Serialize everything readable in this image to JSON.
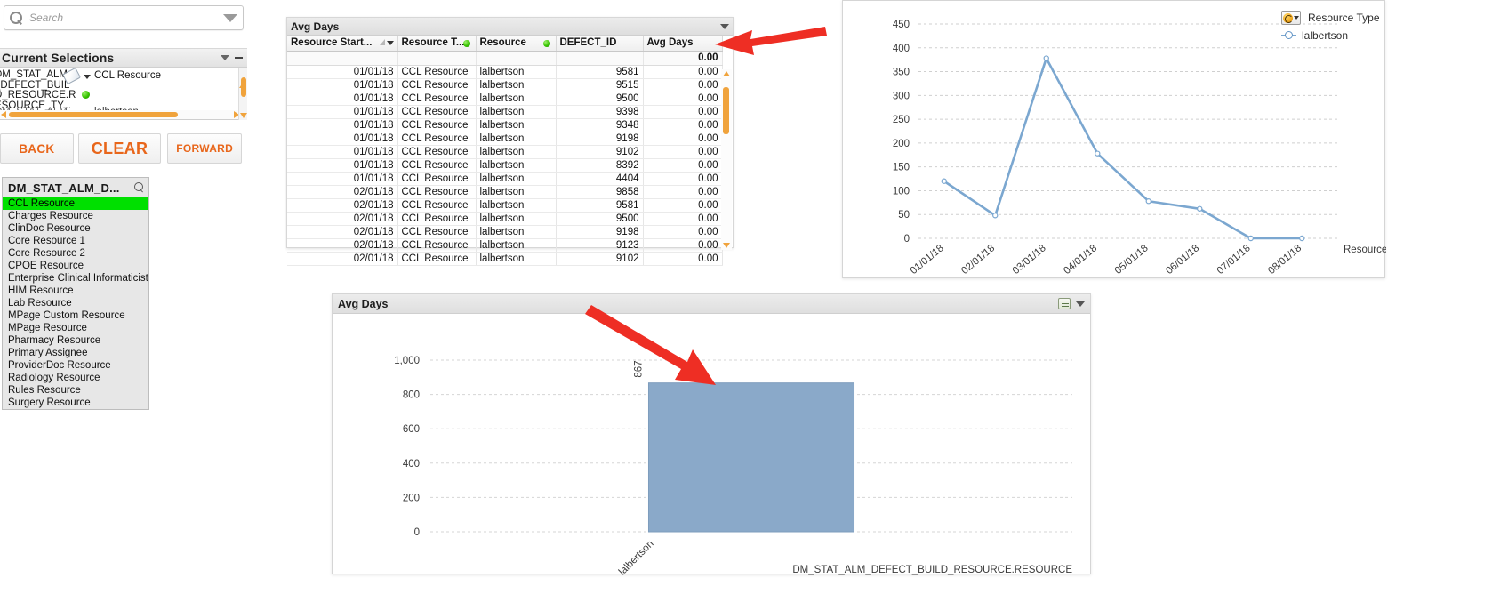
{
  "search": {
    "placeholder": "Search",
    "icon": "search-icon"
  },
  "current_selections": {
    "title": "Current Selections",
    "field_lines": [
      "DM_STAT_ALM",
      "_DEFECT_BUIL",
      "D_RESOURCE.R",
      "ESOURCE_TY..."
    ],
    "value": "CCL Resource",
    "row2_field": "DM_STAT_ALM...",
    "row2_value": "lalbertson",
    "collapse_icon": "chevron-down-icon",
    "minimize_icon": "minimize-icon"
  },
  "nav": {
    "back": "BACK",
    "clear": "CLEAR",
    "forward": "FORWARD"
  },
  "listbox": {
    "title": "DM_STAT_ALM_D...",
    "search_icon": "search-icon",
    "selected": "CCL Resource",
    "items": [
      "CCL Resource",
      "Charges Resource",
      "ClinDoc Resource",
      "Core Resource 1",
      "Core Resource 2",
      "CPOE Resource",
      "Enterprise Clinical Informaticist",
      "HIM Resource",
      "Lab Resource",
      "MPage Custom Resource",
      "MPage Resource",
      "Pharmacy Resource",
      "Primary Assignee",
      "ProviderDoc Resource",
      "Radiology Resource",
      "Rules Resource",
      "Surgery Resource"
    ]
  },
  "table": {
    "caption": "Avg Days",
    "columns": [
      "Resource Start...",
      "Resource T...",
      "Resource",
      "DEFECT_ID",
      "Avg Days"
    ],
    "total_row": {
      "label": "",
      "avg_days": "0.00"
    },
    "rows": [
      {
        "start": "01/01/18",
        "type": "CCL Resource",
        "resource": "lalbertson",
        "defect_id": "9581",
        "avg_days": "0.00"
      },
      {
        "start": "01/01/18",
        "type": "CCL Resource",
        "resource": "lalbertson",
        "defect_id": "9515",
        "avg_days": "0.00"
      },
      {
        "start": "01/01/18",
        "type": "CCL Resource",
        "resource": "lalbertson",
        "defect_id": "9500",
        "avg_days": "0.00"
      },
      {
        "start": "01/01/18",
        "type": "CCL Resource",
        "resource": "lalbertson",
        "defect_id": "9398",
        "avg_days": "0.00"
      },
      {
        "start": "01/01/18",
        "type": "CCL Resource",
        "resource": "lalbertson",
        "defect_id": "9348",
        "avg_days": "0.00"
      },
      {
        "start": "01/01/18",
        "type": "CCL Resource",
        "resource": "lalbertson",
        "defect_id": "9198",
        "avg_days": "0.00"
      },
      {
        "start": "01/01/18",
        "type": "CCL Resource",
        "resource": "lalbertson",
        "defect_id": "9102",
        "avg_days": "0.00"
      },
      {
        "start": "01/01/18",
        "type": "CCL Resource",
        "resource": "lalbertson",
        "defect_id": "8392",
        "avg_days": "0.00"
      },
      {
        "start": "01/01/18",
        "type": "CCL Resource",
        "resource": "lalbertson",
        "defect_id": "4404",
        "avg_days": "0.00"
      },
      {
        "start": "02/01/18",
        "type": "CCL Resource",
        "resource": "lalbertson",
        "defect_id": "9858",
        "avg_days": "0.00"
      },
      {
        "start": "02/01/18",
        "type": "CCL Resource",
        "resource": "lalbertson",
        "defect_id": "9581",
        "avg_days": "0.00"
      },
      {
        "start": "02/01/18",
        "type": "CCL Resource",
        "resource": "lalbertson",
        "defect_id": "9500",
        "avg_days": "0.00"
      },
      {
        "start": "02/01/18",
        "type": "CCL Resource",
        "resource": "lalbertson",
        "defect_id": "9198",
        "avg_days": "0.00"
      },
      {
        "start": "02/01/18",
        "type": "CCL Resource",
        "resource": "lalbertson",
        "defect_id": "9123",
        "avg_days": "0.00"
      },
      {
        "start": "02/01/18",
        "type": "CCL Resource",
        "resource": "lalbertson",
        "defect_id": "9102",
        "avg_days": "0.00"
      }
    ]
  },
  "line_legend": {
    "header": "Resource Type",
    "entry": "lalbertson"
  },
  "bar_panel": {
    "caption": "Avg Days",
    "chart_icon": "chart-type-icon",
    "caret_icon": "chevron-down-icon"
  },
  "colors": {
    "accent_orange": "#e8661b",
    "scroll_orange": "#f0a33c",
    "selection_green": "#00e000",
    "line_series": "#7ba7d0",
    "bar_fill": "#8aa9c9",
    "arrow_red": "#ee2e24"
  },
  "chart_data": [
    {
      "type": "line",
      "title": "",
      "xlabel": "Resource Start Date",
      "ylabel": "",
      "x": [
        "01/01/18",
        "02/01/18",
        "03/01/18",
        "04/01/18",
        "05/01/18",
        "06/01/18",
        "07/01/18",
        "08/01/18"
      ],
      "series": [
        {
          "name": "lalbertson",
          "values": [
            120,
            48,
            378,
            178,
            78,
            62,
            0,
            0
          ]
        }
      ],
      "ylim": [
        0,
        450
      ],
      "yticks": [
        0,
        50,
        100,
        150,
        200,
        250,
        300,
        350,
        400,
        450
      ],
      "grid": true,
      "legend_position": "right"
    },
    {
      "type": "bar",
      "title": "Avg Days",
      "xlabel": "DM_STAT_ALM_DEFECT_BUILD_RESOURCE.RESOURCE",
      "ylabel": "",
      "categories": [
        "lalbertson"
      ],
      "values": [
        867
      ],
      "data_labels": [
        "867"
      ],
      "ylim": [
        0,
        1000
      ],
      "yticks": [
        0,
        200,
        400,
        600,
        800,
        1000
      ],
      "ytick_labels": [
        "0",
        "200",
        "400",
        "600",
        "800",
        "1,000"
      ],
      "grid": true
    }
  ]
}
